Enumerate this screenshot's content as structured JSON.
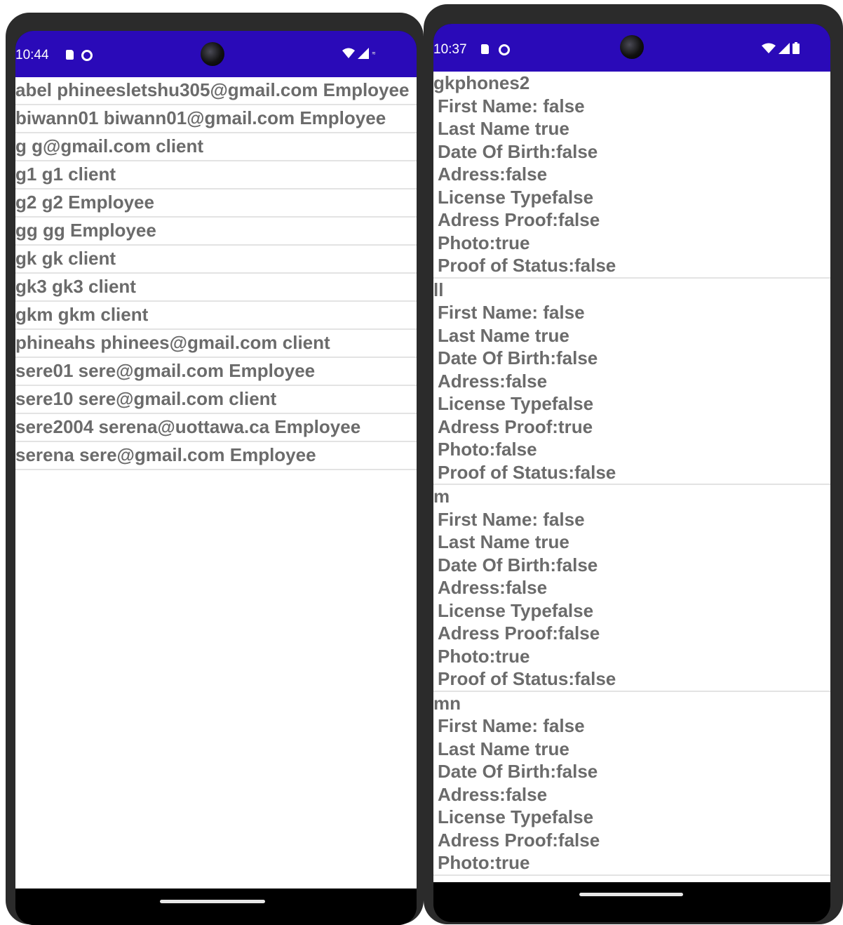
{
  "left_phone": {
    "status": {
      "time": "10:44"
    },
    "users": [
      "abel phineesletshu305@gmail.com Employee",
      "biwann01 biwann01@gmail.com Employee",
      "g g@gmail.com client",
      "g1 g1 client",
      "g2 g2 Employee",
      "gg gg Employee",
      "gk gk client",
      "gk3 gk3 client",
      "gkm gkm client",
      "phineahs phinees@gmail.com client",
      "sere01 sere@gmail.com Employee",
      "sere10 sere@gmail.com client",
      "sere2004 serena@uottawa.ca Employee",
      "serena sere@gmail.com Employee"
    ]
  },
  "right_phone": {
    "status": {
      "time": "10:37"
    },
    "requests": [
      {
        "name": "gkphones2",
        "fields": [
          "First Name: false",
          "Last Name true",
          "Date Of Birth:false",
          "Adress:false",
          "License Typefalse",
          "Adress Proof:false",
          "Photo:true",
          "Proof of Status:false"
        ]
      },
      {
        "name": "ll",
        "fields": [
          "First Name: false",
          "Last Name true",
          "Date Of Birth:false",
          "Adress:false",
          "License Typefalse",
          "Adress Proof:true",
          "Photo:false",
          "Proof of Status:false"
        ]
      },
      {
        "name": "m",
        "fields": [
          "First Name: false",
          "Last Name true",
          "Date Of Birth:false",
          "Adress:false",
          "License Typefalse",
          "Adress Proof:false",
          "Photo:true",
          "Proof of Status:false"
        ]
      },
      {
        "name": "mn",
        "fields": [
          "First Name: false",
          "Last Name true",
          "Date Of Birth:false",
          "Adress:false",
          "License Typefalse",
          "Adress Proof:false",
          "Photo:true"
        ]
      }
    ]
  },
  "colors": {
    "status_bar": "#2a0ab8",
    "text": "#6b6b6b",
    "divider": "#e3e3e3",
    "frame": "#2b2b2b"
  },
  "icons": [
    "sd-card-icon",
    "sync-icon",
    "camera-icon",
    "wifi-icon",
    "signal-icon",
    "battery-icon",
    "home-pill-icon"
  ]
}
